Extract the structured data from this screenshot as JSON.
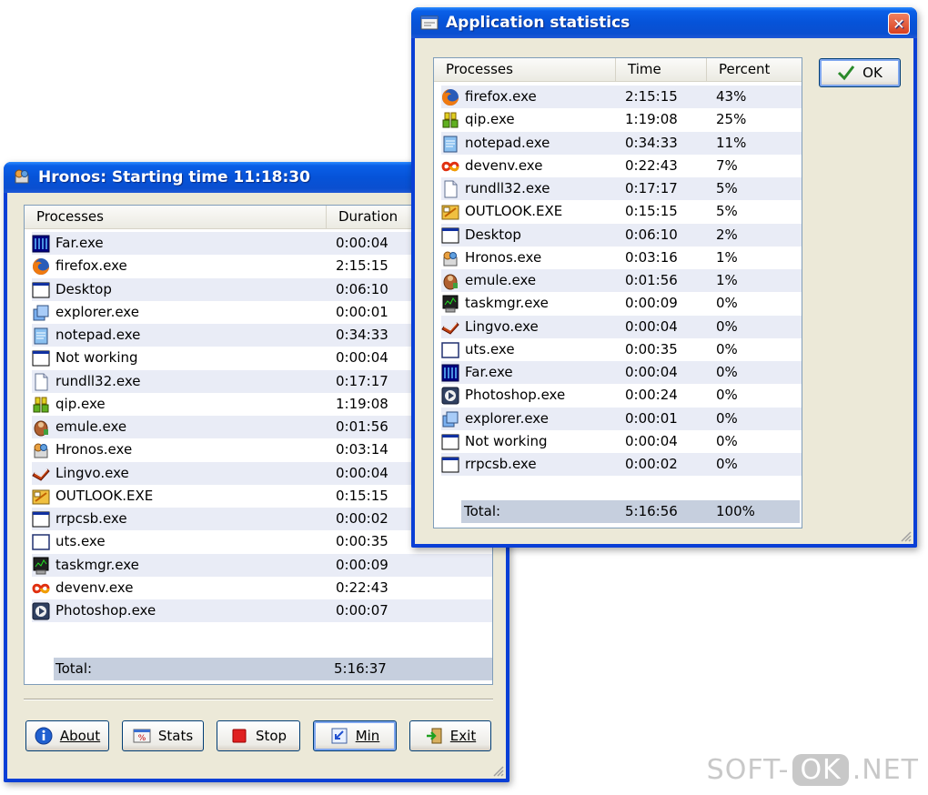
{
  "hronos": {
    "title": "Hronos: Starting time 11:18:30",
    "columns": [
      "Processes",
      "Duration"
    ],
    "rows": [
      {
        "name": "Far.exe",
        "duration": "0:00:04",
        "icon": "far-icon"
      },
      {
        "name": "firefox.exe",
        "duration": "2:15:15",
        "icon": "firefox-icon"
      },
      {
        "name": "Desktop",
        "duration": "0:06:10",
        "icon": "window-icon"
      },
      {
        "name": "explorer.exe",
        "duration": "0:00:01",
        "icon": "explorer-icon"
      },
      {
        "name": "notepad.exe",
        "duration": "0:34:33",
        "icon": "notepad-icon"
      },
      {
        "name": "Not working",
        "duration": "0:00:04",
        "icon": "window-icon"
      },
      {
        "name": "rundll32.exe",
        "duration": "0:17:17",
        "icon": "file-icon"
      },
      {
        "name": "qip.exe",
        "duration": "1:19:08",
        "icon": "qip-icon"
      },
      {
        "name": "emule.exe",
        "duration": "0:01:56",
        "icon": "emule-icon"
      },
      {
        "name": "Hronos.exe",
        "duration": "0:03:14",
        "icon": "hronos-icon"
      },
      {
        "name": "Lingvo.exe",
        "duration": "0:00:04",
        "icon": "lingvo-icon"
      },
      {
        "name": "OUTLOOK.EXE",
        "duration": "0:15:15",
        "icon": "outlook-icon"
      },
      {
        "name": "rrpcsb.exe",
        "duration": "0:00:02",
        "icon": "window-icon"
      },
      {
        "name": "uts.exe",
        "duration": "0:00:35",
        "icon": "blank-window-icon"
      },
      {
        "name": "taskmgr.exe",
        "duration": "0:00:09",
        "icon": "taskmgr-icon"
      },
      {
        "name": "devenv.exe",
        "duration": "0:22:43",
        "icon": "devenv-icon"
      },
      {
        "name": "Photoshop.exe",
        "duration": "0:00:07",
        "icon": "photoshop-icon"
      }
    ],
    "total_label": "Total:",
    "total_value": "5:16:37",
    "buttons": {
      "about": "About",
      "stats": "Stats",
      "stop": "Stop",
      "min": "Min",
      "exit": "Exit"
    }
  },
  "stats": {
    "title": "Application statistics",
    "columns": [
      "Processes",
      "Time",
      "Percent"
    ],
    "rows": [
      {
        "name": "firefox.exe",
        "time": "2:15:15",
        "percent": "43%",
        "icon": "firefox-icon"
      },
      {
        "name": "qip.exe",
        "time": "1:19:08",
        "percent": "25%",
        "icon": "qip-icon"
      },
      {
        "name": "notepad.exe",
        "time": "0:34:33",
        "percent": "11%",
        "icon": "notepad-icon"
      },
      {
        "name": "devenv.exe",
        "time": "0:22:43",
        "percent": "7%",
        "icon": "devenv-icon"
      },
      {
        "name": "rundll32.exe",
        "time": "0:17:17",
        "percent": "5%",
        "icon": "file-icon"
      },
      {
        "name": "OUTLOOK.EXE",
        "time": "0:15:15",
        "percent": "5%",
        "icon": "outlook-icon"
      },
      {
        "name": "Desktop",
        "time": "0:06:10",
        "percent": "2%",
        "icon": "window-icon"
      },
      {
        "name": "Hronos.exe",
        "time": "0:03:16",
        "percent": "1%",
        "icon": "hronos-icon"
      },
      {
        "name": "emule.exe",
        "time": "0:01:56",
        "percent": "1%",
        "icon": "emule-icon"
      },
      {
        "name": "taskmgr.exe",
        "time": "0:00:09",
        "percent": "0%",
        "icon": "taskmgr-icon"
      },
      {
        "name": "Lingvo.exe",
        "time": "0:00:04",
        "percent": "0%",
        "icon": "lingvo-icon"
      },
      {
        "name": "uts.exe",
        "time": "0:00:35",
        "percent": "0%",
        "icon": "blank-window-icon"
      },
      {
        "name": "Far.exe",
        "time": "0:00:04",
        "percent": "0%",
        "icon": "far-icon"
      },
      {
        "name": "Photoshop.exe",
        "time": "0:00:24",
        "percent": "0%",
        "icon": "photoshop-icon"
      },
      {
        "name": "explorer.exe",
        "time": "0:00:01",
        "percent": "0%",
        "icon": "explorer-icon"
      },
      {
        "name": "Not working",
        "time": "0:00:04",
        "percent": "0%",
        "icon": "window-icon"
      },
      {
        "name": "rrpcsb.exe",
        "time": "0:00:02",
        "percent": "0%",
        "icon": "window-icon"
      }
    ],
    "total_label": "Total:",
    "total_time": "5:16:56",
    "total_percent": "100%",
    "ok_label": "OK",
    "close_glyph": "✕"
  },
  "watermark": {
    "left": "SOFT-",
    "mid": "OK",
    "right": ".NET"
  }
}
